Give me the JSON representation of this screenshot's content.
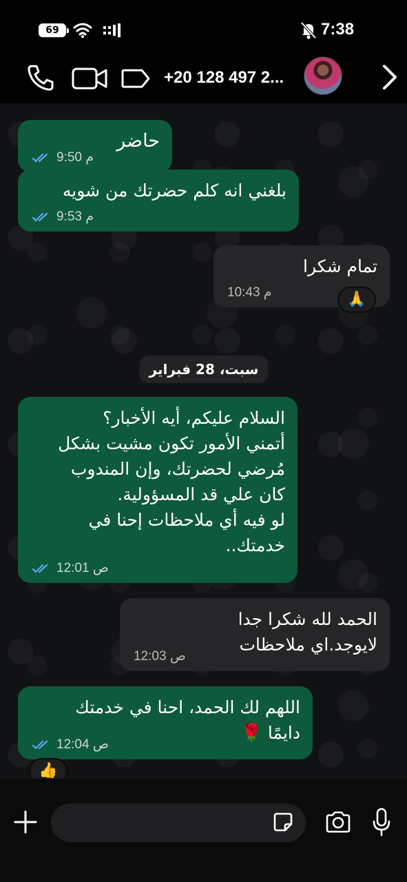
{
  "status_bar": {
    "battery": "69",
    "time": "7:38"
  },
  "header": {
    "contact": "+20 128 497 2..."
  },
  "messages": [
    {
      "text": "حاضر",
      "time": "9:50 م"
    },
    {
      "text": "بلغني انه كلم حضرتك من شويه",
      "time": "9:53 م"
    },
    {
      "text": "تمام شكرا",
      "time": "10:43 م",
      "reaction": "🙏"
    },
    {
      "text": "السلام عليكم، أيه الأخبار؟\nأتمني الأمور تكون مشيت بشكل\nمُرضي لحضرتك، وإن المندوب\nكان علي قد المسؤولية.\nلو فيه أي ملاحظات إحنا في\nخدمتك..",
      "time": "12:01 ص"
    },
    {
      "text": "الحمد لله شكرا جدا\nلايوجد.اي ملاحظات",
      "time": "12:03 ص"
    },
    {
      "text": "اللهم لك الحمد، احنا في خدمتك\nدايمًا 🌹",
      "time": "12:04 ص",
      "reaction": "👍"
    }
  ],
  "date_separator": "سبت، 28 فبراير",
  "composer": {
    "placeholder": ""
  },
  "colors": {
    "incoming_bubble": "#0e5a3c",
    "outgoing_bubble": "#262628",
    "tick_blue": "#5aa9ff"
  }
}
